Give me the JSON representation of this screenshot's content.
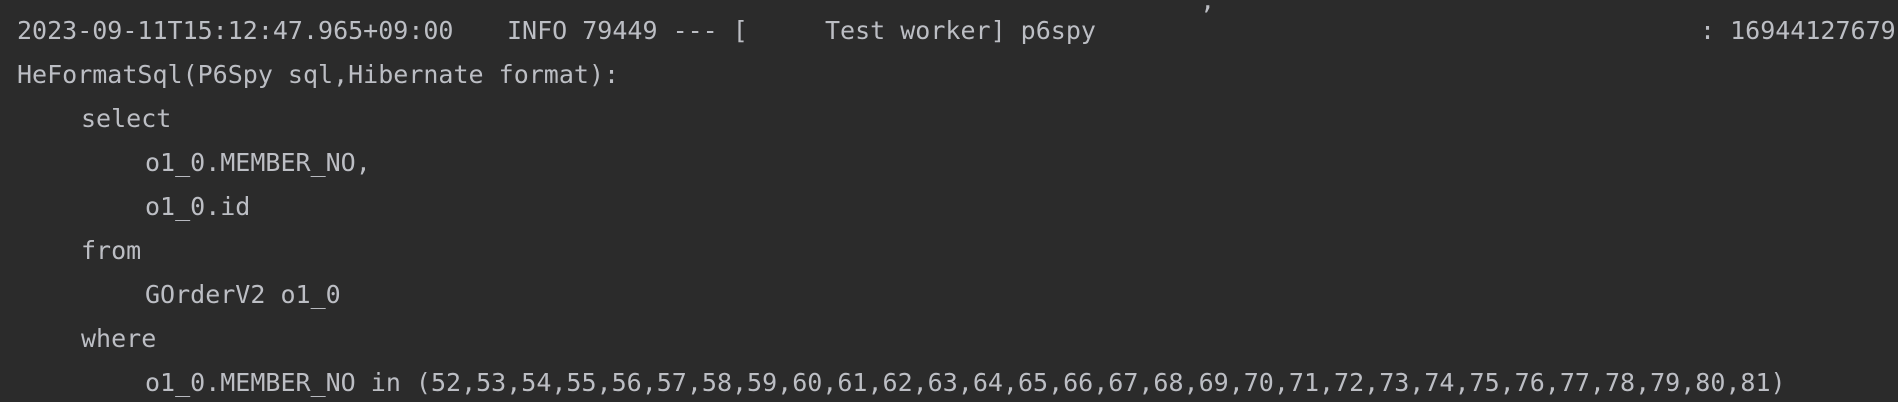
{
  "console": {
    "header": {
      "timestamp": "2023-09-11T15:12:47.965+09:00",
      "level_pid": "INFO 79449 --- [",
      "thread_logger": "Test worker] p6spy",
      "tail": ": 16944127679"
    },
    "cut_top_fragment": "' ,",
    "lines": [
      "HeFormatSql(P6Spy sql,Hibernate format):",
      "select",
      "o1_0.MEMBER_NO,",
      "o1_0.id",
      "from",
      "GOrderV2 o1_0",
      "where",
      "o1_0.MEMBER_NO in (52,53,54,55,56,57,58,59,60,61,62,63,64,65,66,67,68,69,70,71,72,73,74,75,76,77,78,79,80,81)"
    ]
  }
}
